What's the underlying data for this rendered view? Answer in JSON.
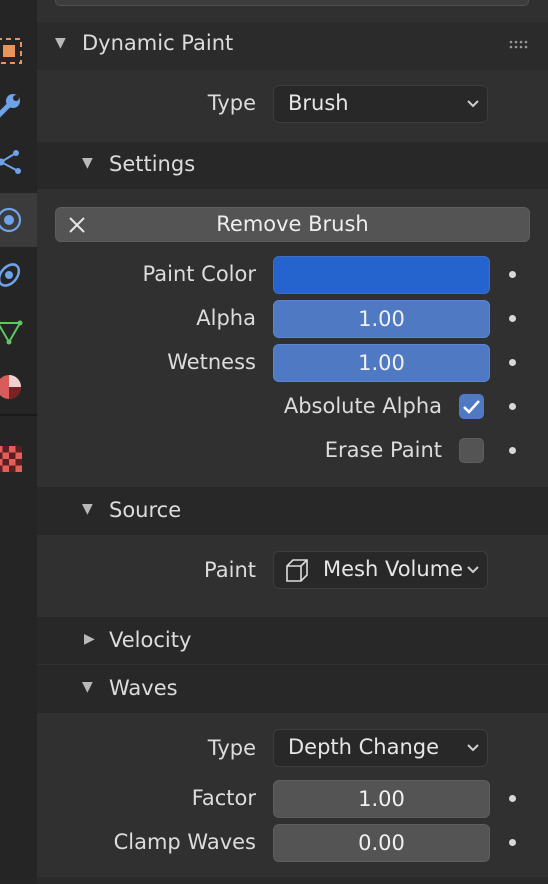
{
  "dynamic_paint": {
    "title": "Dynamic Paint",
    "type_label": "Type",
    "type_value": "Brush"
  },
  "settings": {
    "title": "Settings",
    "remove_brush": "Remove Brush",
    "paint_color_label": "Paint Color",
    "paint_color": "#2563cf",
    "alpha_label": "Alpha",
    "alpha_value": "1.00",
    "wetness_label": "Wetness",
    "wetness_value": "1.00",
    "absolute_alpha_label": "Absolute Alpha",
    "absolute_alpha_checked": true,
    "erase_paint_label": "Erase Paint",
    "erase_paint_checked": false
  },
  "source": {
    "title": "Source",
    "paint_label": "Paint",
    "paint_value": "Mesh Volume"
  },
  "velocity": {
    "title": "Velocity"
  },
  "waves": {
    "title": "Waves",
    "type_label": "Type",
    "type_value": "Depth Change",
    "factor_label": "Factor",
    "factor_value": "1.00",
    "clamp_label": "Clamp Waves",
    "clamp_value": "0.00"
  },
  "tabs": [
    {
      "icon": "object-icon"
    },
    {
      "icon": "wrench-icon"
    },
    {
      "icon": "particles-icon"
    },
    {
      "icon": "physics-icon"
    },
    {
      "icon": "constraints-icon"
    },
    {
      "icon": "mesh-data-icon"
    },
    {
      "icon": "material-icon"
    },
    {
      "icon": "texture-icon"
    }
  ]
}
